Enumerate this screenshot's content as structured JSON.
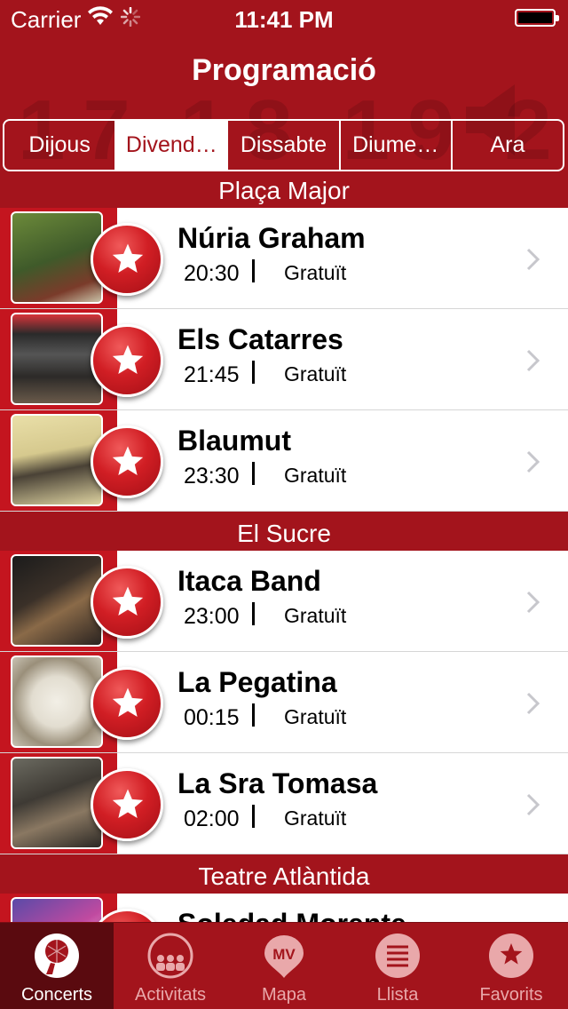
{
  "status_bar": {
    "carrier": "Carrier",
    "time": "11:41 PM"
  },
  "header": {
    "title": "Programació",
    "background_numbers": [
      "17",
      "18",
      "19",
      "20"
    ]
  },
  "day_tabs": [
    {
      "label": "Dijous",
      "active": false
    },
    {
      "label": "Divend…",
      "active": true
    },
    {
      "label": "Dissabte",
      "active": false
    },
    {
      "label": "Diume…",
      "active": false
    },
    {
      "label": "Ara",
      "active": false
    }
  ],
  "sections": [
    {
      "title": "Plaça Major",
      "concerts": [
        {
          "name": "Núria Graham",
          "time": "20:30",
          "price": "Gratuït"
        },
        {
          "name": "Els Catarres",
          "time": "21:45",
          "price": "Gratuït"
        },
        {
          "name": "Blaumut",
          "time": "23:30",
          "price": "Gratuït"
        }
      ]
    },
    {
      "title": "El Sucre",
      "concerts": [
        {
          "name": "Itaca Band",
          "time": "23:00",
          "price": "Gratuït"
        },
        {
          "name": "La Pegatina",
          "time": "00:15",
          "price": "Gratuït"
        },
        {
          "name": "La Sra Tomasa",
          "time": "02:00",
          "price": "Gratuït"
        }
      ]
    },
    {
      "title": "Teatre Atlàntida",
      "concerts": [
        {
          "name": "Soledad Morente",
          "time": "",
          "price": ""
        }
      ]
    }
  ],
  "tab_bar": [
    {
      "label": "Concerts",
      "icon": "microphone-icon",
      "active": true
    },
    {
      "label": "Activitats",
      "icon": "audience-icon",
      "active": false
    },
    {
      "label": "Mapa",
      "icon": "map-pin-icon",
      "active": false
    },
    {
      "label": "Llista",
      "icon": "list-icon",
      "active": false
    },
    {
      "label": "Favorits",
      "icon": "star-icon",
      "active": false
    }
  ],
  "colors": {
    "brand_red": "#a3141c",
    "active_tab": "#5a0a0f",
    "star_button": "#d11e24"
  }
}
